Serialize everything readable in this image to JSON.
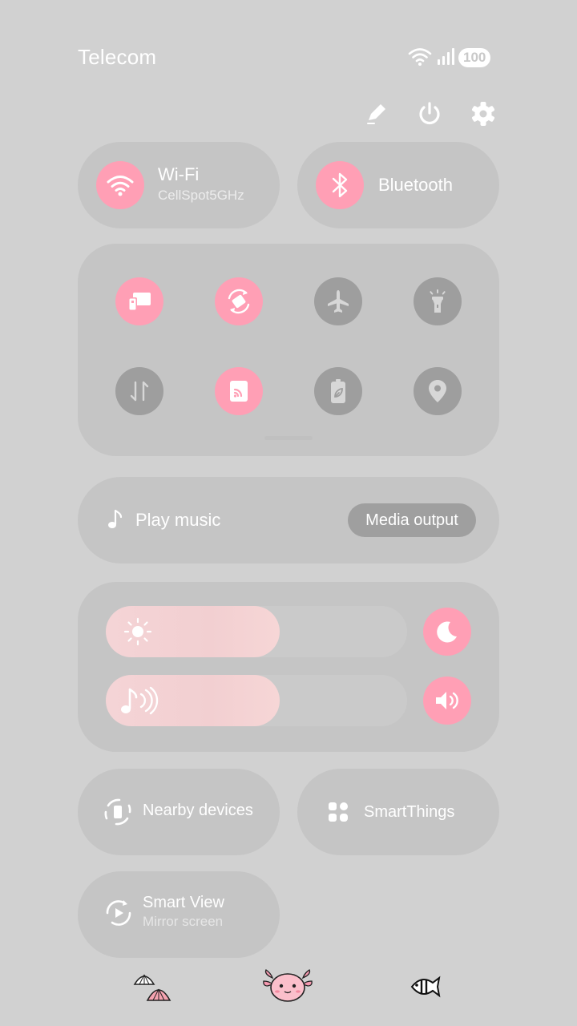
{
  "status_bar": {
    "carrier": "Telecom",
    "battery": "100",
    "icons": [
      "wifi-icon",
      "signal-icon"
    ]
  },
  "top_actions": [
    "edit-icon",
    "power-icon",
    "settings-icon"
  ],
  "big_tiles": {
    "wifi": {
      "label": "Wi-Fi",
      "sub": "CellSpot5GHz",
      "state": "on"
    },
    "bluetooth": {
      "label": "Bluetooth",
      "state": "on"
    }
  },
  "quick_toggles": [
    {
      "icon": "multi-window-icon",
      "state": "on"
    },
    {
      "icon": "auto-rotate-icon",
      "state": "on"
    },
    {
      "icon": "airplane-icon",
      "state": "off"
    },
    {
      "icon": "flashlight-icon",
      "state": "off"
    },
    {
      "icon": "mobile-data-icon",
      "state": "off"
    },
    {
      "icon": "cast-icon",
      "state": "on"
    },
    {
      "icon": "power-saving-icon",
      "state": "off"
    },
    {
      "icon": "location-icon",
      "state": "off"
    }
  ],
  "media": {
    "label": "Play music",
    "button": "Media output"
  },
  "sliders": {
    "brightness": {
      "level": 0.57,
      "icon": "sun-icon",
      "side_icon": "moon-icon"
    },
    "volume": {
      "level": 0.57,
      "icon": "music-note-icon",
      "side_icon": "speaker-icon"
    }
  },
  "bottom_tiles": {
    "nearby": {
      "label": "Nearby devices"
    },
    "smartthings": {
      "label": "SmartThings"
    },
    "smartview": {
      "label": "Smart View",
      "sub": "Mirror screen"
    }
  },
  "colors": {
    "background": "#d1d1d1",
    "tile": "#c5c5c5",
    "accent": "#ff9fb5",
    "off": "#9e9e9e"
  }
}
